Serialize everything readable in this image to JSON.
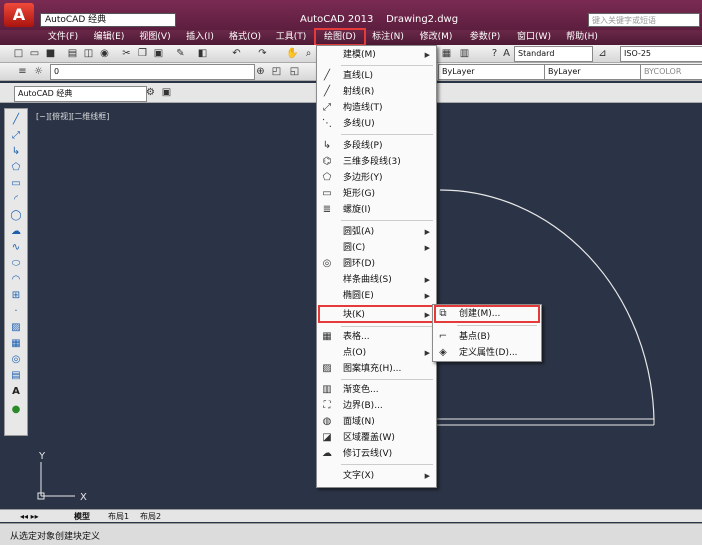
{
  "window": {
    "workspace": "AutoCAD 经典",
    "title": "AutoCAD 2013    Drawing2.dwg",
    "search_placeholder": "键入关键字或短语",
    "app_letter": "A"
  },
  "menubar": [
    {
      "label": "文件(F)"
    },
    {
      "label": "编辑(E)"
    },
    {
      "label": "视图(V)"
    },
    {
      "label": "插入(I)"
    },
    {
      "label": "格式(O)"
    },
    {
      "label": "工具(T)"
    },
    {
      "label": "绘图(D)"
    },
    {
      "label": "标注(N)"
    },
    {
      "label": "修改(M)"
    },
    {
      "label": "参数(P)"
    },
    {
      "label": "窗口(W)"
    },
    {
      "label": "帮助(H)"
    }
  ],
  "toolbar": {
    "text_style": "Standard",
    "dim_style": "ISO-25",
    "layer": "0",
    "linetype": "ByLayer",
    "lineweight": "ByLayer",
    "plotstyle": "BYCOLOR",
    "workspace2": "AutoCAD 经典"
  },
  "viewport_label": "[−][俯视][二维线框]",
  "draw_menu": [
    {
      "label": "建模(M)",
      "submenu": true,
      "icon": "none"
    },
    {
      "label": "直线(L)",
      "icon": "line-icon"
    },
    {
      "label": "射线(R)",
      "icon": "ray-icon"
    },
    {
      "label": "构造线(T)",
      "icon": "xline-icon"
    },
    {
      "label": "多线(U)",
      "icon": "mline-icon"
    },
    {
      "label": "多段线(P)",
      "icon": "pline-icon"
    },
    {
      "label": "三维多段线(3)",
      "icon": "3dpoly-icon"
    },
    {
      "label": "多边形(Y)",
      "icon": "polygon-icon"
    },
    {
      "label": "矩形(G)",
      "icon": "rectangle-icon"
    },
    {
      "label": "螺旋(I)",
      "icon": "helix-icon"
    },
    {
      "label": "圆弧(A)",
      "submenu": true,
      "icon": "none"
    },
    {
      "label": "圆(C)",
      "submenu": true,
      "icon": "none"
    },
    {
      "label": "圆环(D)",
      "icon": "donut-icon"
    },
    {
      "label": "样条曲线(S)",
      "submenu": true,
      "icon": "none"
    },
    {
      "label": "椭圆(E)",
      "submenu": true,
      "icon": "none"
    },
    {
      "label": "块(K)",
      "submenu": true,
      "icon": "none"
    },
    {
      "label": "表格...",
      "icon": "table-icon"
    },
    {
      "label": "点(O)",
      "submenu": true,
      "icon": "none"
    },
    {
      "label": "图案填充(H)...",
      "icon": "hatch-icon"
    },
    {
      "label": "渐变色...",
      "icon": "gradient-icon"
    },
    {
      "label": "边界(B)...",
      "icon": "boundary-icon"
    },
    {
      "label": "面域(N)",
      "icon": "region-icon"
    },
    {
      "label": "区域覆盖(W)",
      "icon": "wipeout-icon"
    },
    {
      "label": "修订云线(V)",
      "icon": "revcloud-icon"
    },
    {
      "label": "文字(X)",
      "submenu": true,
      "icon": "none"
    }
  ],
  "block_submenu": [
    {
      "label": "创建(M)..."
    },
    {
      "label": "基点(B)"
    },
    {
      "label": "定义属性(D)..."
    }
  ],
  "tabs": [
    "模型",
    "布局1",
    "布局2"
  ],
  "status_text": "从选定对象创建块定义",
  "ucs": {
    "y": "Y",
    "x": "X"
  },
  "colors": {
    "canvas": "#2b3446",
    "title_bar": "#6a2848",
    "highlight_box": "#e43a3a",
    "arc": "#e8e8e8"
  }
}
